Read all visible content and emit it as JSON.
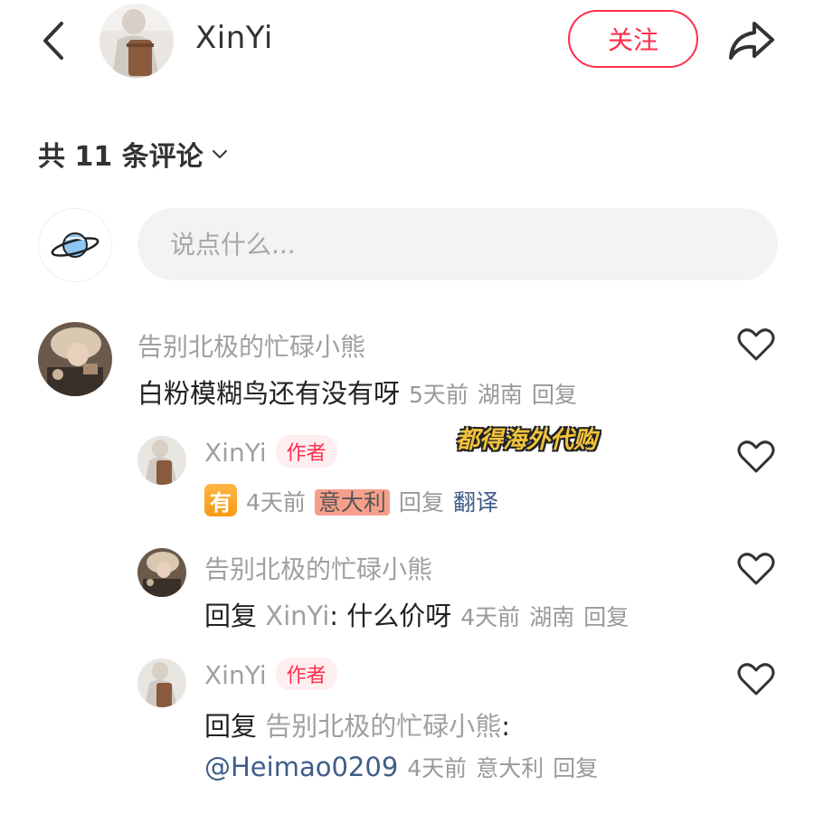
{
  "header": {
    "username": "XinYi",
    "follow_label": "关注"
  },
  "comments_header": {
    "count_label": "共 11 条评论"
  },
  "composer": {
    "placeholder": "说点什么..."
  },
  "overlay": {
    "text": "都得海外代购"
  },
  "comments": [
    {
      "name": "告别北极的忙碌小熊",
      "text": "白粉模糊鸟还有没有呀",
      "time": "5天前",
      "location": "湖南",
      "reply_label": "回复"
    },
    {
      "name": "XinYi",
      "author_tag": "作者",
      "badge": "有",
      "time": "4天前",
      "location": "意大利",
      "reply_label": "回复",
      "translate_label": "翻译"
    },
    {
      "name": "告别北极的忙碌小熊",
      "reply_prefix": "回复",
      "reply_to": "XinYi",
      "text": ": 什么价呀",
      "time": "4天前",
      "location": "湖南",
      "reply_label": "回复"
    },
    {
      "name": "XinYi",
      "author_tag": "作者",
      "reply_prefix": "回复",
      "reply_to": "告别北极的忙碌小熊",
      "reply_suffix": ":",
      "mention": "@Heimao0209",
      "time": "4天前",
      "location": "意大利",
      "reply_label": "回复"
    }
  ],
  "colors": {
    "accent": "#ff2e4d",
    "link": "#3f5d88",
    "muted": "#a0a0a0"
  }
}
